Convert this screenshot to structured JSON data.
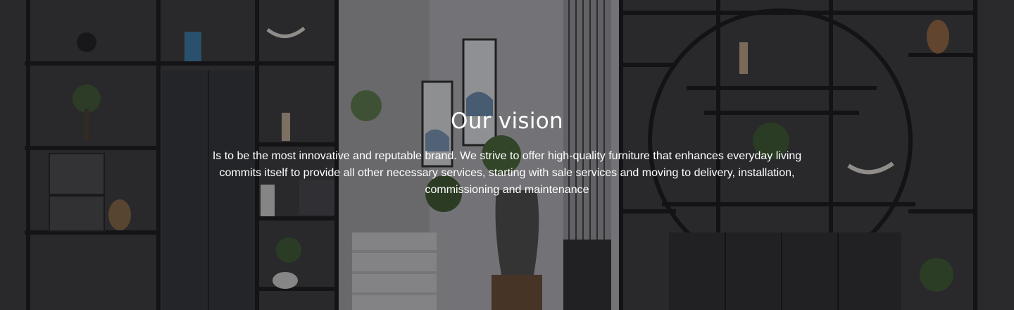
{
  "section": {
    "title": "Our vision",
    "text": "Is to be the most innovative and reputable brand. We strive to offer high-quality furniture that enhances everyday living commits itself to provide all other necessary services, starting with sale services and moving to delivery, installation, commissioning and maintenance"
  },
  "colors": {
    "overlay": "#141416",
    "text": "#ffffff"
  }
}
